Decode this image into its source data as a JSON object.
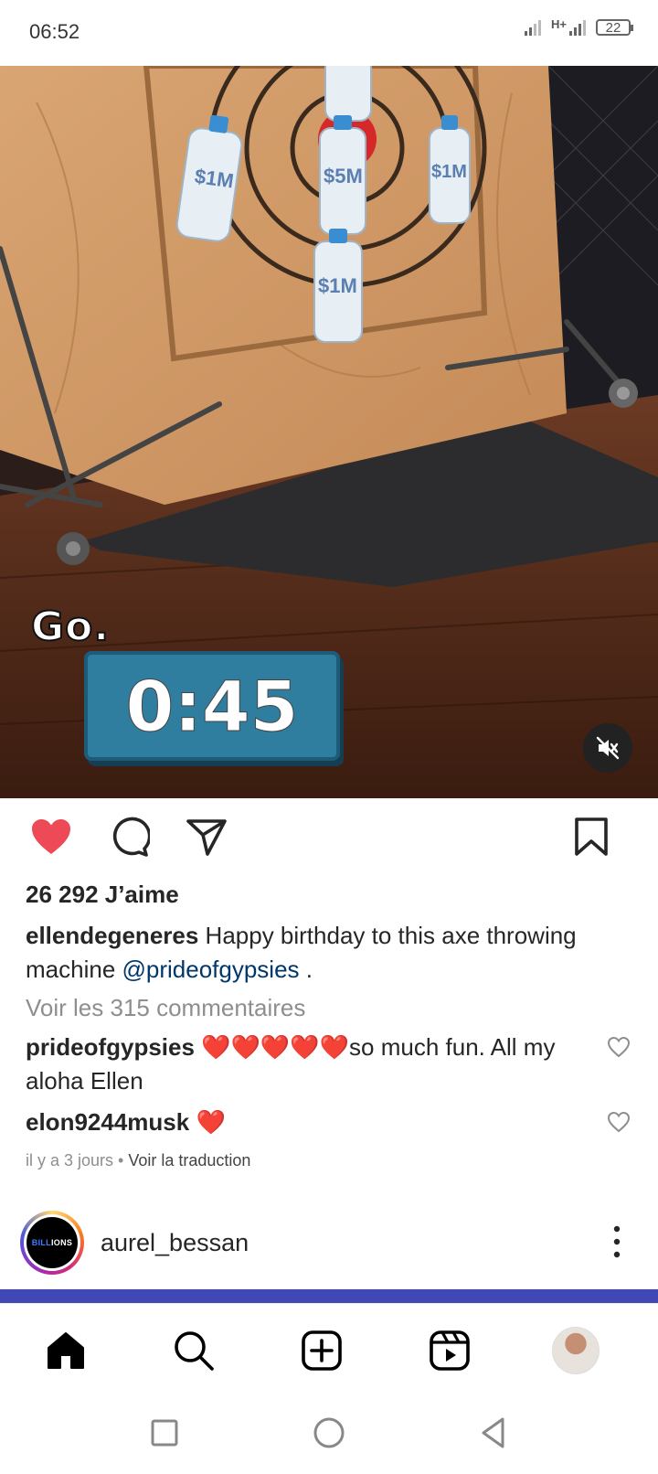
{
  "status_bar": {
    "time": "06:52",
    "network": "H+",
    "battery": "22"
  },
  "video": {
    "overlay_text": "Go.",
    "timer": "0:45",
    "bottle_labels": [
      "$1M",
      "$5M",
      "$1M",
      "$1M"
    ]
  },
  "post": {
    "likes": "26 292 J’aime",
    "author": "ellendegeneres",
    "caption_text": " Happy birthday to this axe throwing machine ",
    "caption_mention": "@prideofgypsies",
    "caption_end": " .",
    "view_comments": "Voir les 315 commentaires",
    "comments": [
      {
        "user": "prideofgypsies",
        "text": " ❤️❤️❤️❤️❤️so much fun.  All my aloha Ellen"
      },
      {
        "user": "elon9244musk",
        "text": " ❤️"
      }
    ],
    "time_ago": "il y a 3 jours",
    "separator": " • ",
    "translate": "Voir la traduction"
  },
  "next_post": {
    "username": "aurel_bessan",
    "avatar_text_a": "BILL",
    "avatar_text_b": "IONS"
  },
  "colors": {
    "like_red": "#ed4956",
    "mention_blue": "#00376b",
    "strip": "#3f48b5"
  },
  "icons": {
    "actions": [
      "heart-icon",
      "comment-icon",
      "share-icon",
      "bookmark-icon"
    ],
    "nav": [
      "home-icon",
      "search-icon",
      "create-icon",
      "reels-icon",
      "profile-avatar"
    ],
    "system": [
      "square-icon",
      "circle-icon",
      "back-triangle-icon"
    ]
  }
}
